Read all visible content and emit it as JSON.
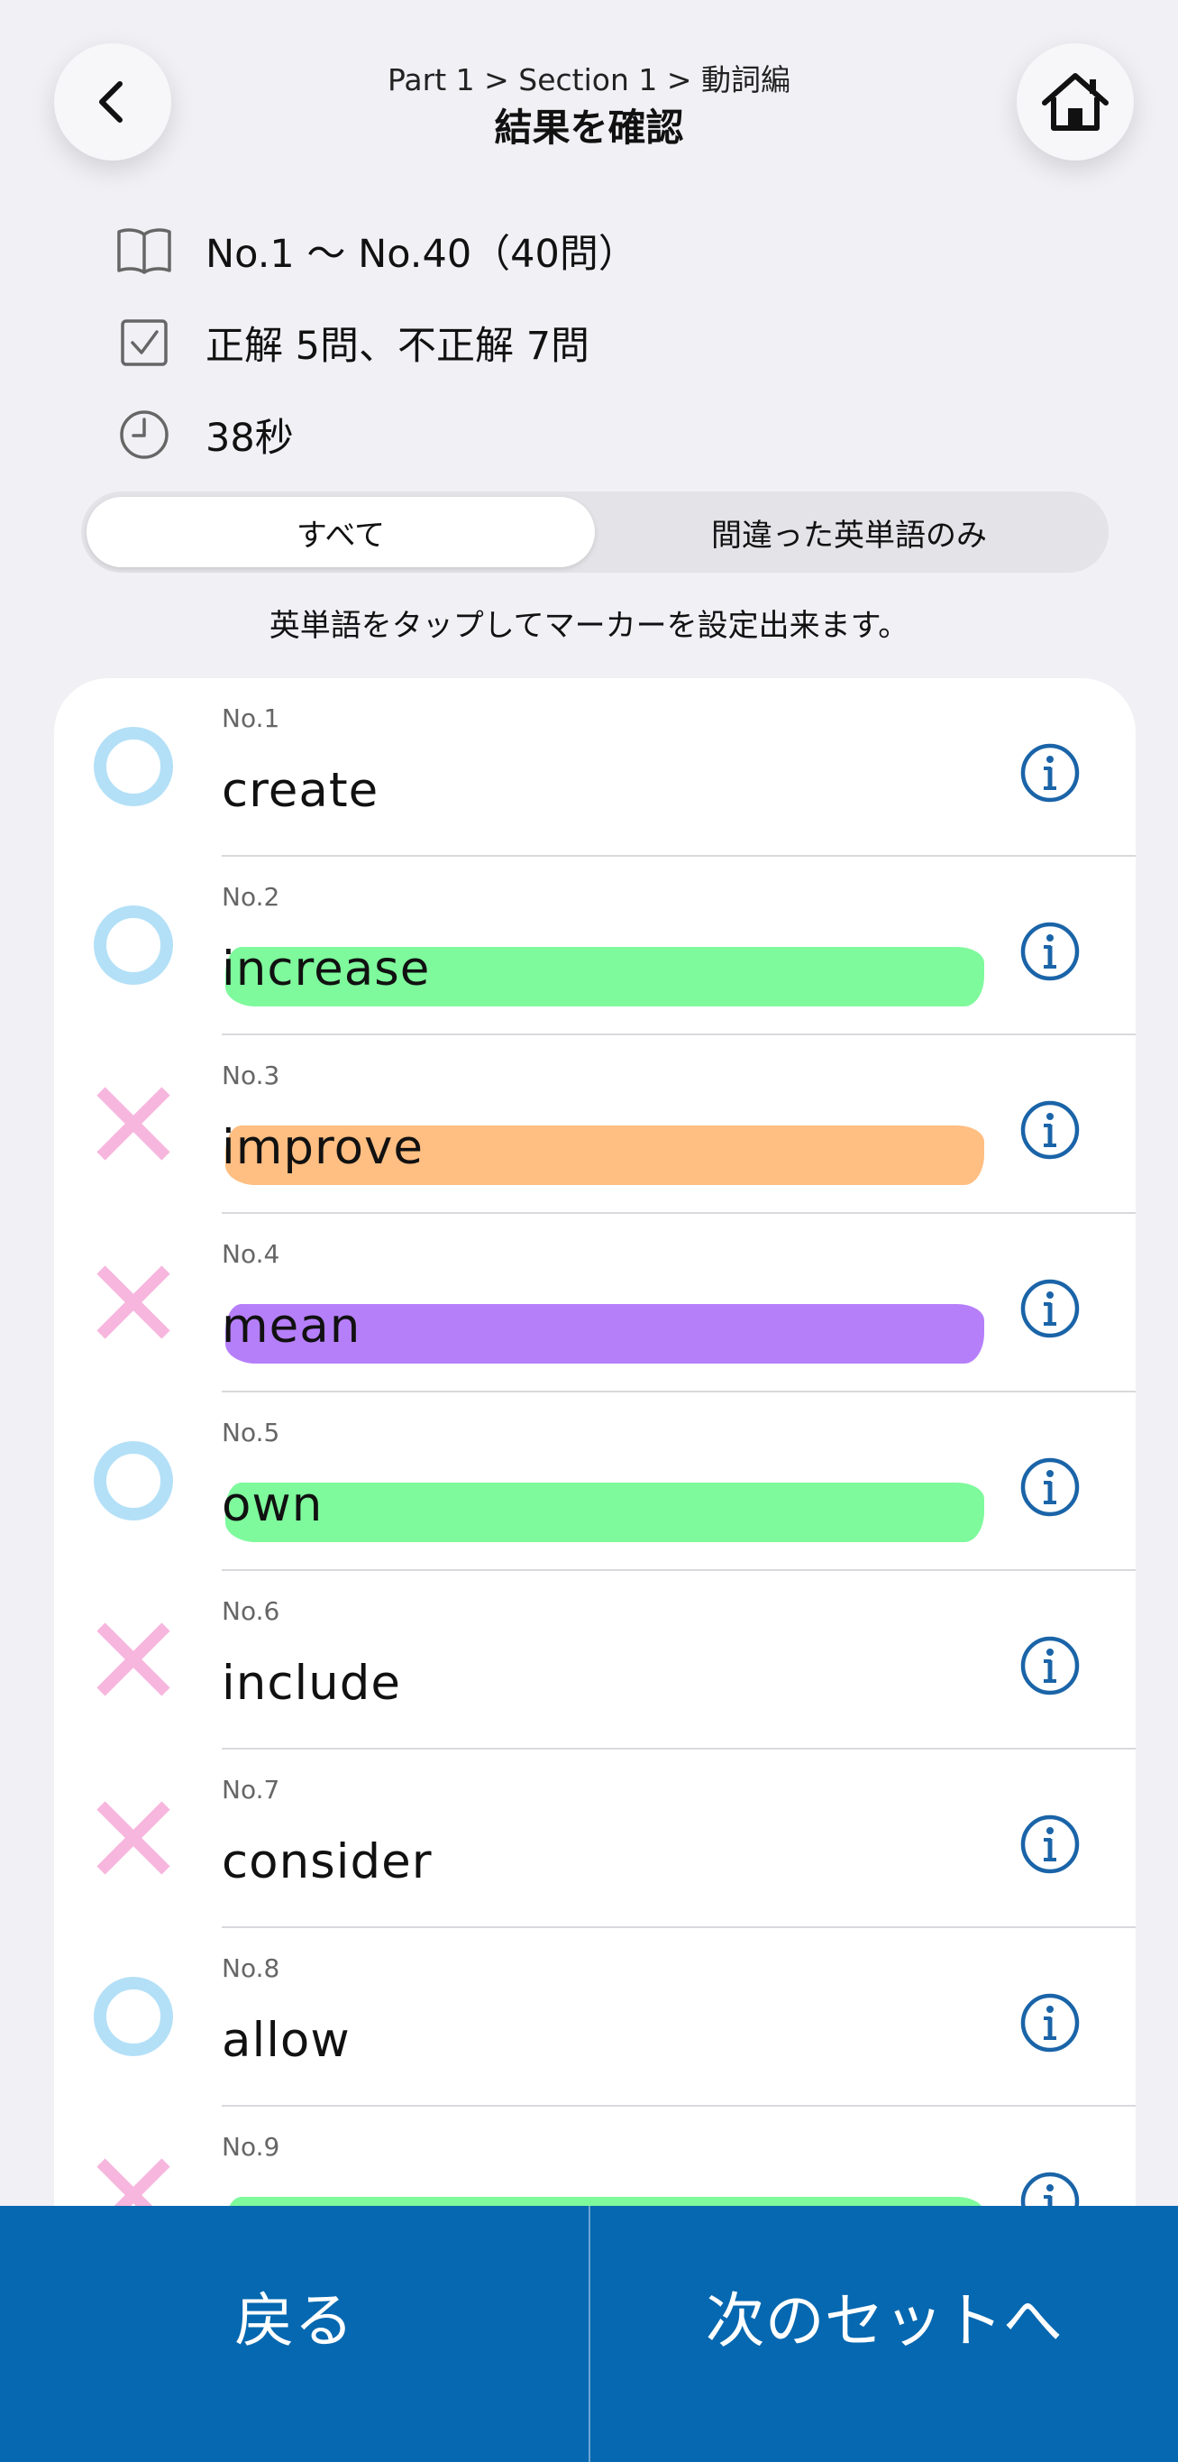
{
  "header": {
    "breadcrumb": "Part 1 > Section 1 > 動詞編",
    "title": "結果を確認"
  },
  "summary": {
    "range": "No.1 〜 No.40（40問）",
    "score": "正解 5問、不正解 7問",
    "time": "38秒"
  },
  "filter": {
    "all": "すべて",
    "wrong_only": "間違った英単語のみ",
    "selected": "すべて"
  },
  "hint": "英単語をタップしてマーカーを設定出来ます。",
  "colors": {
    "correct": "#b3e0f7",
    "incorrect": "#f7b6de",
    "info": "#1a64a8",
    "green_marker": "#7ef99c",
    "orange_marker": "#ffbe82",
    "purple_marker": "#b67ffa",
    "bottom_bar": "#0568b0"
  },
  "items": [
    {
      "num": "No.1",
      "word": "create",
      "result": "correct",
      "marker": null
    },
    {
      "num": "No.2",
      "word": "increase",
      "result": "correct",
      "marker": "green"
    },
    {
      "num": "No.3",
      "word": "improve",
      "result": "incorrect",
      "marker": "orange"
    },
    {
      "num": "No.4",
      "word": "mean",
      "result": "incorrect",
      "marker": "purple"
    },
    {
      "num": "No.5",
      "word": "own",
      "result": "correct",
      "marker": "green"
    },
    {
      "num": "No.6",
      "word": "include",
      "result": "incorrect",
      "marker": null
    },
    {
      "num": "No.7",
      "word": "consider",
      "result": "incorrect",
      "marker": null
    },
    {
      "num": "No.8",
      "word": "allow",
      "result": "correct",
      "marker": null
    },
    {
      "num": "No.9",
      "word": "",
      "result": "incorrect",
      "marker": "green"
    }
  ],
  "footer": {
    "back": "戻る",
    "next": "次のセットへ"
  }
}
